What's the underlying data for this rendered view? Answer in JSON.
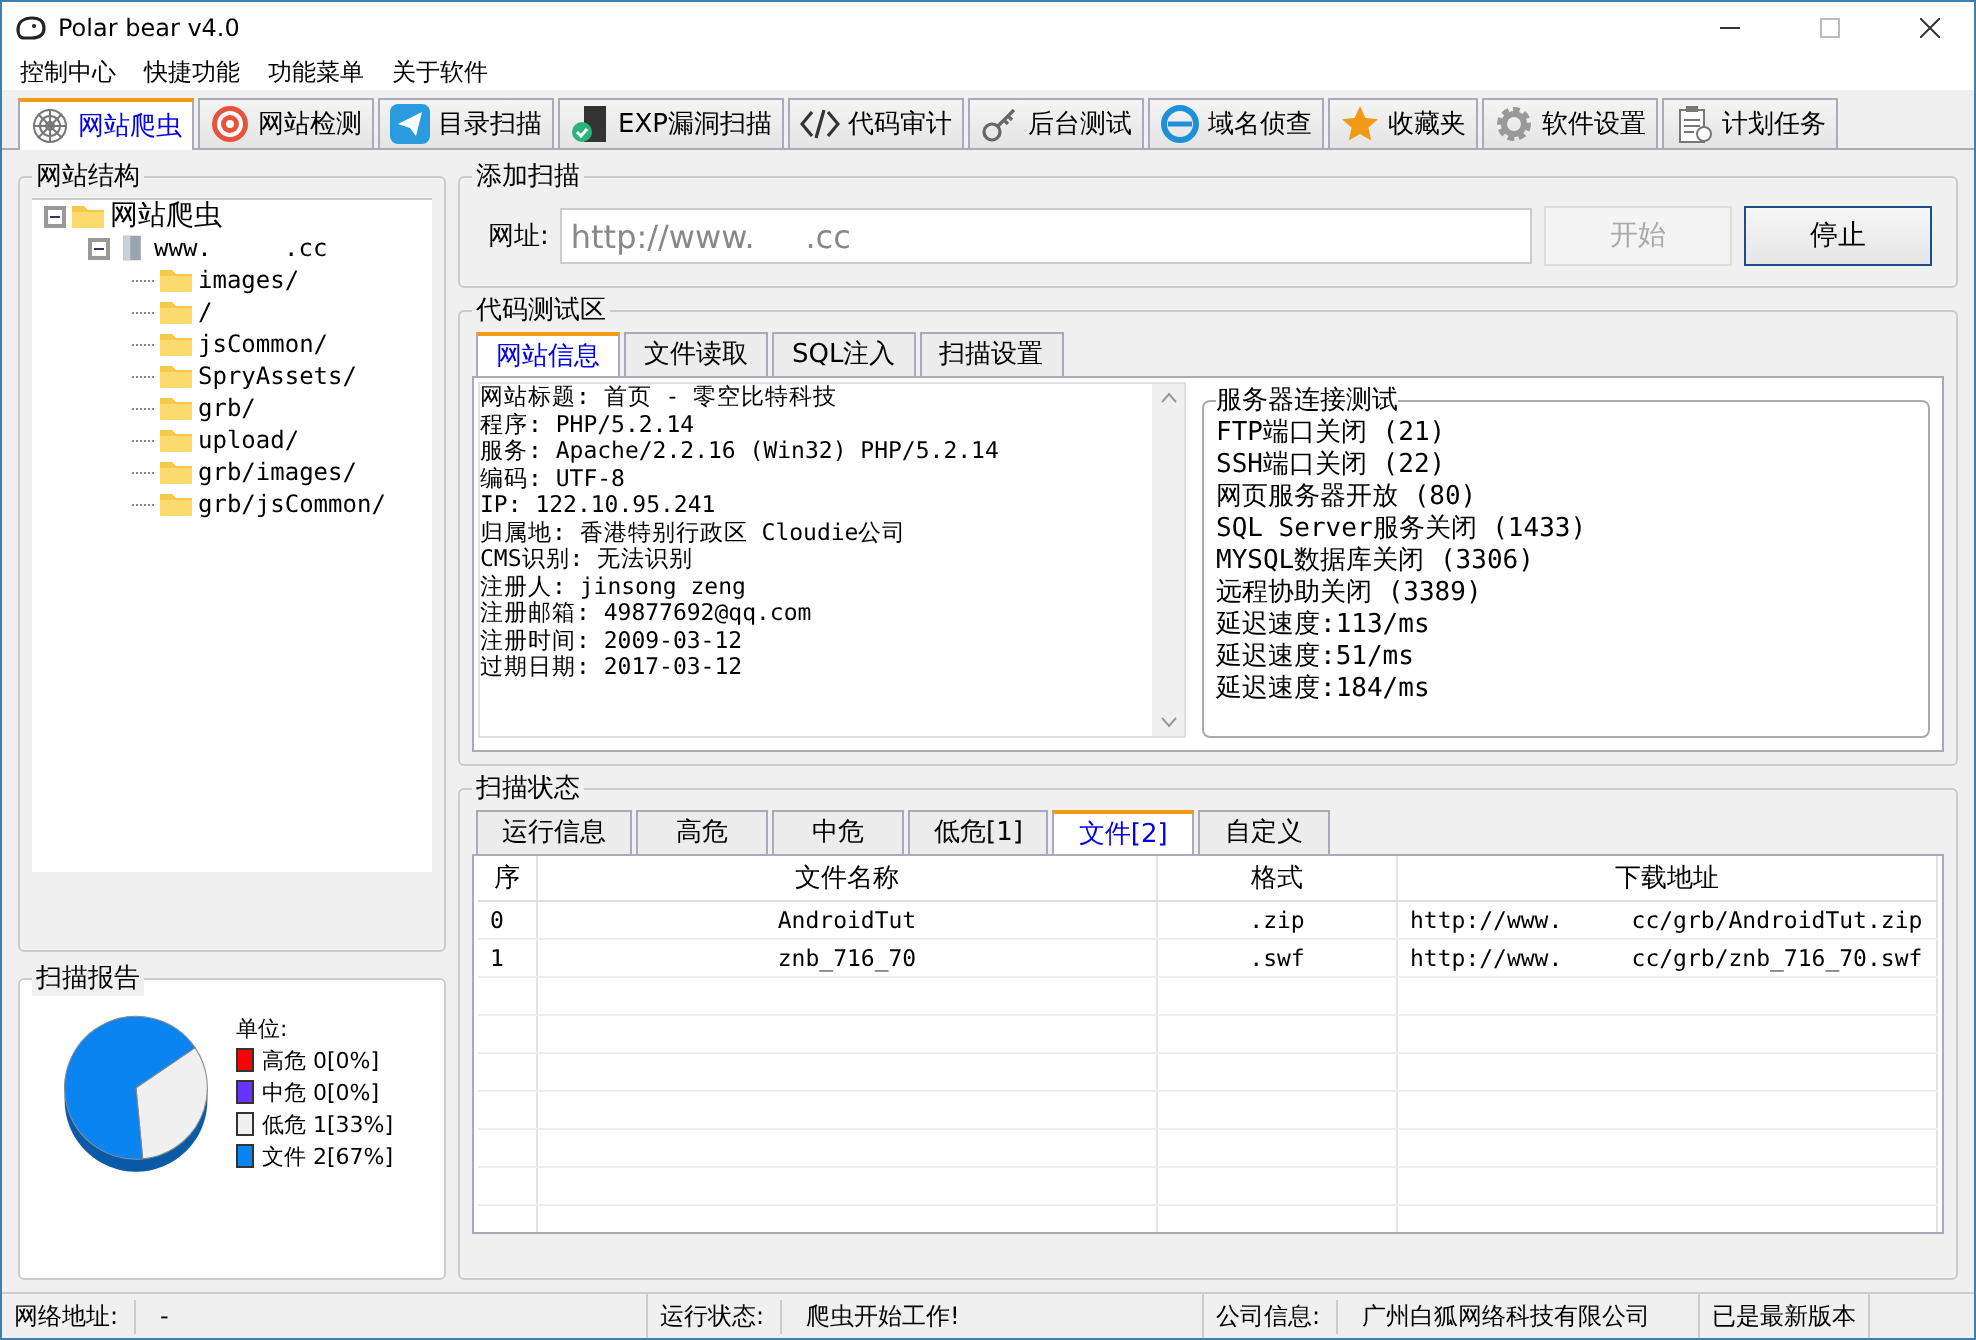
{
  "window": {
    "title": "Polar bear v4.0"
  },
  "menu": [
    "控制中心",
    "快捷功能",
    "功能菜单",
    "关于软件"
  ],
  "tabs": [
    {
      "label": "网站爬虫",
      "selected": true
    },
    {
      "label": "网站检测",
      "selected": false
    },
    {
      "label": "目录扫描",
      "selected": false
    },
    {
      "label": "EXP漏洞扫描",
      "selected": false
    },
    {
      "label": "代码审计",
      "selected": false
    },
    {
      "label": "后台测试",
      "selected": false
    },
    {
      "label": "域名侦查",
      "selected": false
    },
    {
      "label": "收藏夹",
      "selected": false
    },
    {
      "label": "软件设置",
      "selected": false
    },
    {
      "label": "计划任务",
      "selected": false
    }
  ],
  "site_structure": {
    "title": "网站结构",
    "tree": [
      {
        "label": "网站爬虫",
        "kind": "folder",
        "expanded": true,
        "children": [
          {
            "label": "www.     .cc",
            "kind": "server",
            "expanded": true,
            "children": [
              {
                "label": "images/",
                "kind": "folder"
              },
              {
                "label": "/",
                "kind": "folder"
              },
              {
                "label": "jsCommon/",
                "kind": "folder"
              },
              {
                "label": "SpryAssets/",
                "kind": "folder"
              },
              {
                "label": "grb/",
                "kind": "folder"
              },
              {
                "label": "upload/",
                "kind": "folder"
              },
              {
                "label": "grb/images/",
                "kind": "folder"
              },
              {
                "label": "grb/jsCommon/",
                "kind": "folder"
              }
            ]
          }
        ]
      }
    ]
  },
  "scan_report": {
    "title": "扫描报告",
    "unit_label": "单位:",
    "legend": [
      {
        "value": "0[0%]",
        "color": "#ff0000"
      },
      {
        "value": "0[0%]",
        "color": "#6633ff"
      },
      {
        "value": "1[33%]",
        "color": "#f0f0f0"
      },
      {
        "value": "2[67%]",
        "color": "#0a84f0"
      }
    ],
    "chart_data": {
      "type": "pie",
      "categories": [
        "高危",
        "中危",
        "低危",
        "文件"
      ],
      "series": [
        {
          "values": [
            0,
            0,
            33,
            67
          ]
        }
      ]
    }
  },
  "add_scan": {
    "title": "添加扫描",
    "url_label": "网址:",
    "url_value": "http://www.     .cc",
    "start_button": {
      "label": "开始",
      "disabled": true
    },
    "stop_button": {
      "label": "停止",
      "disabled": false
    }
  },
  "code_test": {
    "title": "代码测试区",
    "tabs": [
      {
        "label": "网站信息",
        "selected": true
      },
      {
        "label": "文件读取",
        "selected": false
      },
      {
        "label": "SQL注入",
        "selected": false
      },
      {
        "label": "扫描设置",
        "selected": false
      }
    ],
    "site_info": [
      "网站标题: 首页 - 零空比特科技",
      "程序: PHP/5.2.14",
      "服务: Apache/2.2.16 (Win32) PHP/5.2.14",
      "编码: UTF-8",
      "IP: 122.10.95.241",
      "归属地: 香港特别行政区 Cloudie公司",
      "CMS识别: 无法识别",
      "注册人: jinsong zeng",
      "注册邮箱: 49877692@qq.com",
      "注册时间: 2009-03-12",
      "过期日期: 2017-03-12"
    ],
    "server_test": {
      "title": "服务器连接测试",
      "lines": [
        "FTP端口关闭 (21)",
        "SSH端口关闭 (22)",
        "网页服务器开放 (80)",
        "SQL Server服务关闭 (1433)",
        "MYSQL数据库关闭 (3306)",
        "远程协助关闭 (3389)",
        "延迟速度:113/ms",
        "延迟速度:51/ms",
        "延迟速度:184/ms"
      ]
    }
  },
  "scan_status": {
    "title": "扫描状态",
    "tabs": [
      {
        "label": "运行信息",
        "selected": false
      },
      {
        "label": "高危",
        "selected": false
      },
      {
        "label": "中危",
        "selected": false
      },
      {
        "label": "低危[1]",
        "selected": false
      },
      {
        "label": "文件[2]",
        "selected": true
      },
      {
        "label": "自定义",
        "selected": false
      }
    ],
    "table": {
      "columns": [
        "序",
        "文件名称",
        "格式",
        "下载地址"
      ],
      "rows": [
        [
          "0",
          "AndroidTut",
          ".zip",
          "http://www.     cc/grb/AndroidTut.zip"
        ],
        [
          "1",
          "znb_716_70",
          ".swf",
          "http://www.     cc/grb/znb_716_70.swf"
        ]
      ]
    }
  },
  "status_bar": [
    {
      "label": "网络地址:",
      "value": "-"
    },
    {
      "label": "运行状态:",
      "value": "爬虫开始工作!"
    },
    {
      "label": "公司信息:",
      "value": "广州白狐网络科技有限公司"
    },
    {
      "value": "已是最新版本"
    }
  ]
}
